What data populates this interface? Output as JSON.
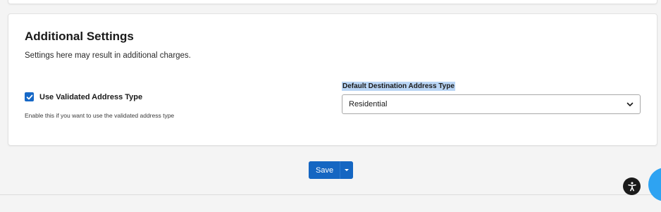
{
  "settings": {
    "title": "Additional Settings",
    "subtitle": "Settings here may result in additional charges.",
    "validated_address": {
      "label": "Use Validated Address Type",
      "checked": true,
      "help": "Enable this if you want to use the validated address type"
    },
    "destination_address": {
      "label": "Default Destination Address Type",
      "value": "Residential"
    }
  },
  "actions": {
    "save_label": "Save"
  },
  "colors": {
    "primary": "#1566c2",
    "label_highlight": "#b9d5f5",
    "chat": "#2ea3f2"
  },
  "icons": {
    "checkbox": "check-icon",
    "select": "chevron-down-icon",
    "save_menu": "caret-down-icon",
    "accessibility": "accessibility-icon"
  }
}
